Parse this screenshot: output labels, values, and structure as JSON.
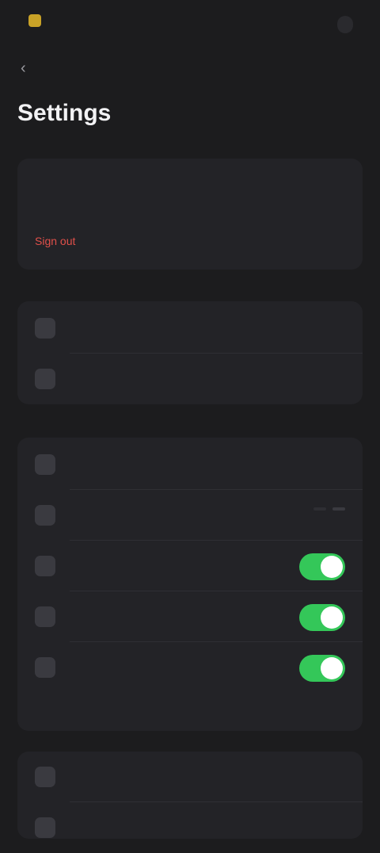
{
  "header": {
    "brand_name": "",
    "account_label": ""
  },
  "page": {
    "back_glyph": "‹",
    "title": "Settings"
  },
  "account": {
    "line1": "",
    "line2": "",
    "sign_out": "Sign out"
  },
  "section_a": {
    "items": [
      {
        "label": ""
      },
      {
        "label": ""
      }
    ]
  },
  "section_b": {
    "items": [
      {
        "label": ""
      },
      {
        "label": "",
        "options": [
          "",
          ""
        ],
        "selected_index": 1
      },
      {
        "label": "",
        "toggle_on": true
      },
      {
        "label": "",
        "toggle_on": true
      },
      {
        "label": "",
        "toggle_on": true
      }
    ],
    "footnote": ""
  },
  "section_c": {
    "items": [
      {
        "label": ""
      },
      {
        "label": ""
      }
    ]
  },
  "colors": {
    "background": "#1c1c1e",
    "card": "#232327",
    "accent_toggle": "#34c759",
    "danger": "#e0504a"
  }
}
